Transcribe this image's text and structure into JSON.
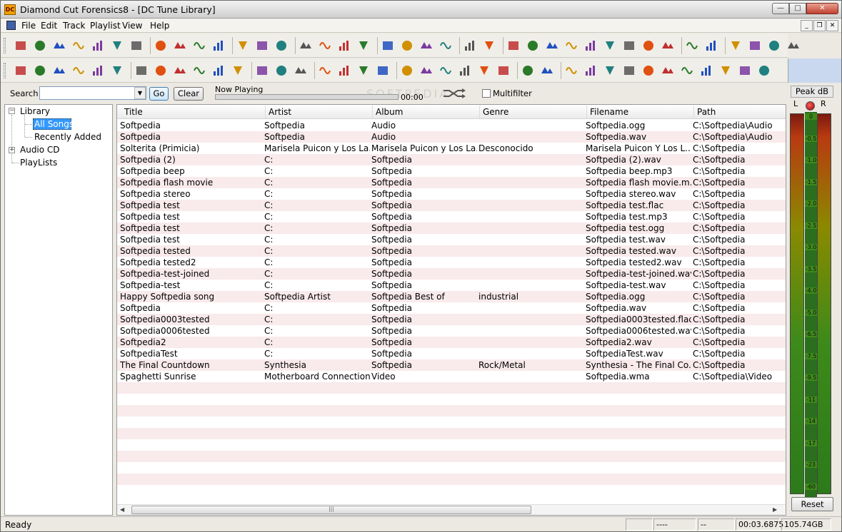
{
  "window": {
    "title": "Diamond Cut Forensics8 - [DC Tune Library]",
    "app_icon_text": "DC"
  },
  "menu": [
    "File",
    "Edit",
    "Track",
    "Playlist",
    "View",
    "Help"
  ],
  "toolbar1_icons": [
    "open-icon",
    "save-icon",
    "cut-icon",
    "copy-icon",
    "paste-icon",
    "print-icon",
    "help-icon",
    "pencil-icon",
    "arrow-up-icon",
    "envelope-icon",
    "brush-icon",
    "stereo-lr-icon",
    "left-channel-icon",
    "right-channel-icon",
    "mixer-icon",
    "dx-icon",
    "cd-disc-icon",
    "notes-icon",
    "eq-z-icon",
    "eq-zz-icon",
    "eq-x-icon",
    "balance-icon",
    "cd-icon",
    "dvd-icon",
    "skip-back-icon",
    "rewind-icon",
    "pause-icon",
    "fast-forward-icon",
    "skip-forward-icon",
    "record-icon",
    "stop-icon",
    "play-icon",
    "loop-icon",
    "cursor-icon",
    "wave-icon",
    "zoom-in-icon",
    "zoom-out-icon",
    "zoom-fit-icon",
    "zoom-all-icon"
  ],
  "toolbar2_icons": [
    "waveform-icon",
    "impulse-icon",
    "spectrum-icon",
    "grid-icon",
    "bars-icon",
    "step-icon",
    "lowpass-icon",
    "bandpass-icon",
    "highpass-icon",
    "notch-icon",
    "x-filter-icon",
    "slope-icon",
    "eq10-icon",
    "eq20-icon",
    "eq30-icon",
    "hill-icon",
    "network-icon",
    "image-icon",
    "pulse-icon",
    "swap-icon",
    "graph-icon",
    "sweep-icon",
    "sine-icon",
    "record-settings-icon",
    "calculator-icon",
    "spectrogram-icon",
    "lips-icon",
    "sparkle-icon",
    "sparkle2-icon",
    "person-icon",
    "horn-icon",
    "tree-icon",
    "grid-green-icon",
    "clock-icon",
    "bowtie-icon",
    "gem-icon",
    "hat-icon",
    "wave-check-icon"
  ],
  "search": {
    "label": "Search",
    "value": "",
    "go": "Go",
    "clear": "Clear"
  },
  "now_playing": {
    "label": "Now Playing",
    "time": "00:00",
    "progress": 0.0,
    "multifilter": "Multifilter",
    "multifilter_checked": false
  },
  "watermark": "SOFTPEDIA",
  "tree": {
    "library": "Library",
    "all_songs": "All Songs",
    "recently_added": "Recently Added",
    "audio_cd": "Audio CD",
    "playlists": "PlayLists"
  },
  "columns": [
    "Title",
    "Artist",
    "Album",
    "Genre",
    "Filename",
    "Path"
  ],
  "rows": [
    [
      "Softpedia",
      "Softpedia",
      "Audio",
      "",
      "Softpedia.ogg",
      "C:\\Softpedia\\Audio"
    ],
    [
      "Softpedia",
      "Softpedia",
      "Audio",
      "",
      "Softpedia.wav",
      "C:\\Softpedia\\Audio"
    ],
    [
      "Solterita (Primicia)",
      "Marisela Puicon y Los La...",
      "Marisela Puicon y Los La...",
      "Desconocido",
      "Marisela Puicon Y Los L...",
      "C:\\Softpedia"
    ],
    [
      "Softpedia (2)",
      "C:",
      "Softpedia",
      "",
      "Softpedia (2).wav",
      "C:\\Softpedia"
    ],
    [
      "Softpedia beep",
      "C:",
      "Softpedia",
      "",
      "Softpedia beep.mp3",
      "C:\\Softpedia"
    ],
    [
      "Softpedia flash movie",
      "C:",
      "Softpedia",
      "",
      "Softpedia flash movie.m...",
      "C:\\Softpedia"
    ],
    [
      "Softpedia stereo",
      "C:",
      "Softpedia",
      "",
      "Softpedia stereo.wav",
      "C:\\Softpedia"
    ],
    [
      "Softpedia test",
      "C:",
      "Softpedia",
      "",
      "Softpedia test.flac",
      "C:\\Softpedia"
    ],
    [
      "Softpedia test",
      "C:",
      "Softpedia",
      "",
      "Softpedia test.mp3",
      "C:\\Softpedia"
    ],
    [
      "Softpedia test",
      "C:",
      "Softpedia",
      "",
      "Softpedia test.ogg",
      "C:\\Softpedia"
    ],
    [
      "Softpedia test",
      "C:",
      "Softpedia",
      "",
      "Softpedia test.wav",
      "C:\\Softpedia"
    ],
    [
      "Softpedia tested",
      "C:",
      "Softpedia",
      "",
      "Softpedia tested.wav",
      "C:\\Softpedia"
    ],
    [
      "Softpedia tested2",
      "C:",
      "Softpedia",
      "",
      "Softpedia tested2.wav",
      "C:\\Softpedia"
    ],
    [
      "Softpedia-test-joined",
      "C:",
      "Softpedia",
      "",
      "Softpedia-test-joined.wav",
      "C:\\Softpedia"
    ],
    [
      "Softpedia-test",
      "C:",
      "Softpedia",
      "",
      "Softpedia-test.wav",
      "C:\\Softpedia"
    ],
    [
      "Happy Softpedia song",
      "Softpedia Artist",
      "Softpedia Best of",
      "industrial",
      "Softpedia.ogg",
      "C:\\Softpedia"
    ],
    [
      "Softpedia",
      "C:",
      "Softpedia",
      "",
      "Softpedia.wav",
      "C:\\Softpedia"
    ],
    [
      "Softpedia0003tested",
      "C:",
      "Softpedia",
      "",
      "Softpedia0003tested.flac",
      "C:\\Softpedia"
    ],
    [
      "Softpedia0006tested",
      "C:",
      "Softpedia",
      "",
      "Softpedia0006tested.wav",
      "C:\\Softpedia"
    ],
    [
      "Softpedia2",
      "C:",
      "Softpedia",
      "",
      "Softpedia2.wav",
      "C:\\Softpedia"
    ],
    [
      "SoftpediaTest",
      "C:",
      "Softpedia",
      "",
      "SoftpediaTest.wav",
      "C:\\Softpedia"
    ],
    [
      "The Final Countdown",
      "Synthesia",
      "Softpedia",
      "Rock/Metal",
      "Synthesia - The Final Co...",
      "C:\\Softpedia"
    ],
    [
      "Spaghetti Sunrise",
      "Motherboard Connection",
      "Video",
      "",
      "Softpedia.wma",
      "C:\\Softpedia\\Video"
    ]
  ],
  "vu": {
    "title": "Peak dB",
    "left": "L",
    "right": "R",
    "scale": [
      "0",
      "-0.5",
      "-1.0",
      "-1.5",
      "-2.0",
      "-2.5",
      "-3.0",
      "-3.5",
      "-4.0",
      "-5.0",
      "-6.5",
      "-7.5",
      "-9.5",
      "-11",
      "-14",
      "-17",
      "-23",
      "-60"
    ],
    "reset": "Reset"
  },
  "status": {
    "text": "Ready",
    "p1": "",
    "p2": "----",
    "p3": "--",
    "time": "00:03.6875",
    "disk": "105.74GB"
  },
  "colors": {
    "accent": "#3399ff",
    "alt_row": "#f9eaec"
  }
}
